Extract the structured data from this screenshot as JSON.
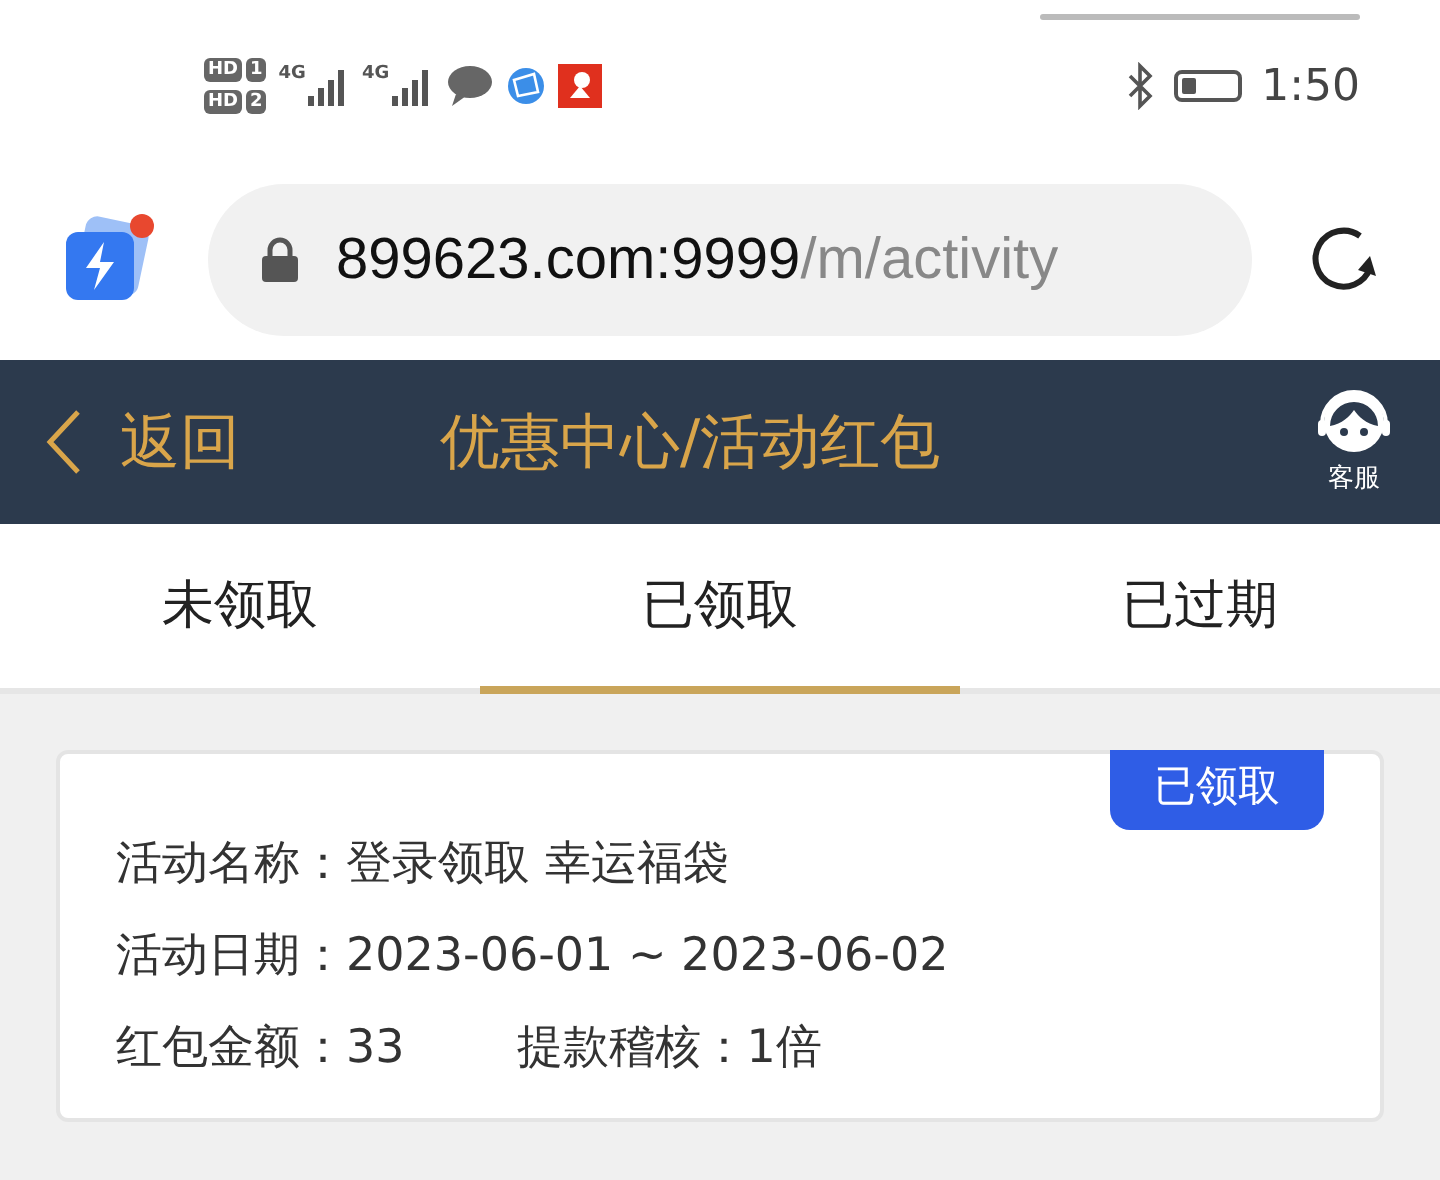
{
  "status_bar": {
    "sims": [
      {
        "hd": "HD",
        "slot": "1"
      },
      {
        "hd": "HD",
        "slot": "2"
      }
    ],
    "networks": [
      "4G",
      "4G"
    ],
    "time": "1:50"
  },
  "address_bar": {
    "host": "899623.com:9999",
    "path": "/m/activity"
  },
  "header": {
    "back": "返回",
    "title": "优惠中心/活动红包",
    "service": "客服"
  },
  "tabs": [
    {
      "label": "未领取",
      "selected": false
    },
    {
      "label": "已领取",
      "selected": true
    },
    {
      "label": "已过期",
      "selected": false
    }
  ],
  "records": [
    {
      "badge": "已领取",
      "rows": [
        [
          {
            "label": "活动名称：",
            "value": "登录领取 幸运福袋"
          }
        ],
        [
          {
            "label": "活动日期：",
            "value": "2023-06-01 ~ 2023-06-02"
          }
        ],
        [
          {
            "label": "红包金额：",
            "value": "33"
          },
          {
            "label": "提款稽核：",
            "value": "1倍"
          }
        ]
      ]
    }
  ]
}
